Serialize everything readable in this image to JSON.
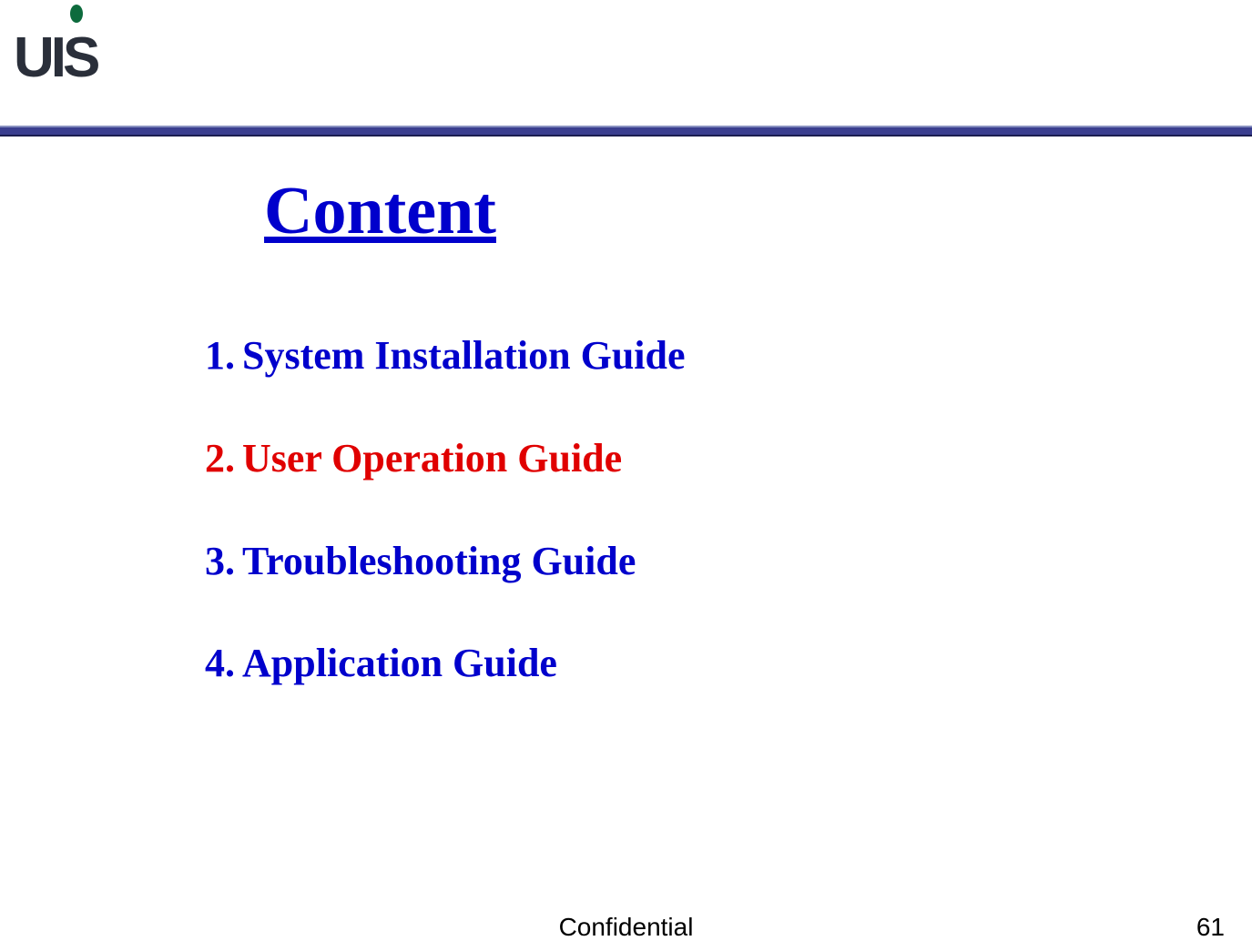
{
  "logo": {
    "text": "UIS"
  },
  "title": "Content",
  "toc": [
    {
      "number": "1.",
      "label": "System Installation Guide",
      "highlight": false
    },
    {
      "number": "2.",
      "label": "User Operation Guide",
      "highlight": true
    },
    {
      "number": "3.",
      "label": "Troubleshooting Guide",
      "highlight": false
    },
    {
      "number": "4.",
      "label": "Application Guide",
      "highlight": false
    }
  ],
  "footer": {
    "center": "Confidential",
    "page": "61"
  },
  "colors": {
    "blue": "#0000cc",
    "red": "#e00000",
    "bar": "#3a3e8f",
    "logoGreen": "#0d6b3d"
  }
}
